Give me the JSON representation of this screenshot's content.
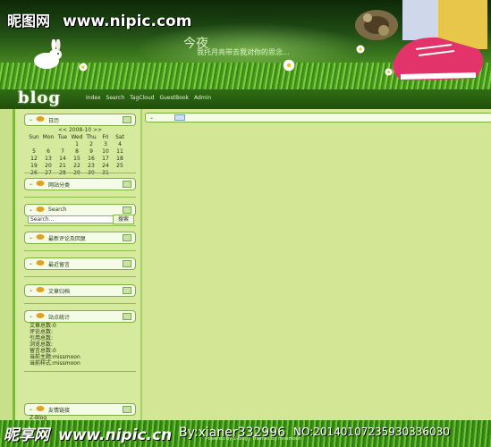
{
  "watermark_top": {
    "brand": "昵图网",
    "url": "www.nipic.com"
  },
  "header": {
    "slogan_line1": "今夜",
    "slogan_line2": "我托月亮带去我对你的思念..."
  },
  "logo": {
    "text": "blog"
  },
  "nav": [
    {
      "label": "Index"
    },
    {
      "label": "Search"
    },
    {
      "label": "TagCloud"
    },
    {
      "label": "GuestBook"
    },
    {
      "label": "Admin"
    }
  ],
  "widgets": {
    "calendar": {
      "title": "日历"
    },
    "categories": {
      "title": "网站分类"
    },
    "search": {
      "title": "Search",
      "button": "搜索",
      "value": "Search..."
    },
    "recent_comments": {
      "title": "最新评论及回复"
    },
    "recent_messages": {
      "title": "最近留言"
    },
    "archives": {
      "title": "文章归档"
    },
    "stats": {
      "title": "站点统计"
    },
    "links": {
      "title": "友情链接"
    }
  },
  "calendar": {
    "title": "<< 2008-10 >>",
    "weekdays": [
      "Sun",
      "Mon",
      "Tue",
      "Wed",
      "Thu",
      "Fri",
      "Sat"
    ],
    "weeks": [
      [
        "",
        "",
        "",
        "1",
        "2",
        "3",
        "4"
      ],
      [
        "5",
        "6",
        "7",
        "8",
        "9",
        "10",
        "11"
      ],
      [
        "12",
        "13",
        "14",
        "15",
        "16",
        "17",
        "18"
      ],
      [
        "19",
        "20",
        "21",
        "22",
        "23",
        "24",
        "25"
      ],
      [
        "26",
        "27",
        "28",
        "29",
        "30",
        "31",
        ""
      ]
    ]
  },
  "stats": [
    {
      "label": "文章总数:0"
    },
    {
      "label": "评论总数:"
    },
    {
      "label": "引用总数:"
    },
    {
      "label": "浏览总数:"
    },
    {
      "label": "留言总数:0"
    },
    {
      "label": "当前主题:missmoon"
    },
    {
      "label": "当前样式:missmoon"
    }
  ],
  "sidebar_footer": "Z-Blog",
  "footer": {
    "powered": "Powered By Z-Blog | Themes By missmoon"
  },
  "watermark_bottom": {
    "brand": "昵享网",
    "url": "www.nipic.cn",
    "by": "By:xianer332996",
    "no": "NO:20140107235930336030"
  },
  "colors": {
    "accent": "#7db83d",
    "page_bg": "#c9e08a",
    "header_dark": "#1f4a14"
  },
  "icons": [
    "rabbit-icon",
    "shoe-icon",
    "bag-icon",
    "daisy-icon",
    "leaf-icon",
    "widget-toggle-icon"
  ]
}
